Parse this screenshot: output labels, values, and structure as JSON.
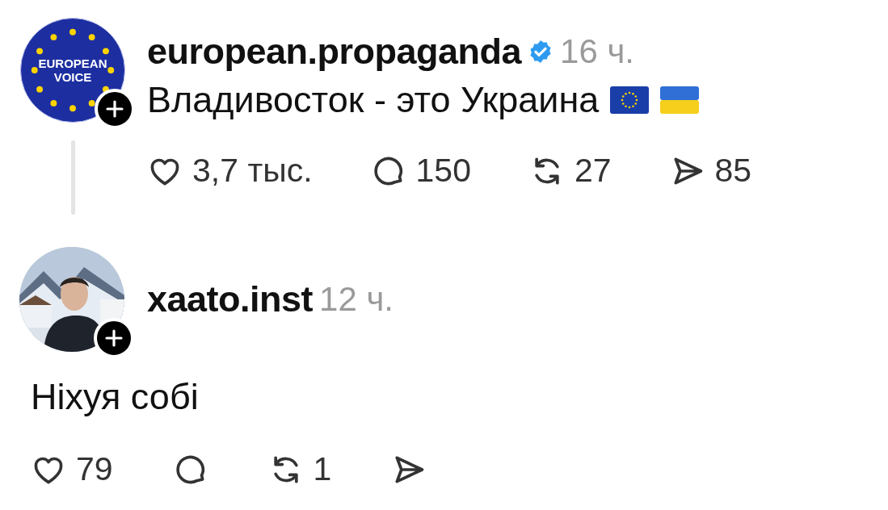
{
  "posts": [
    {
      "avatar": {
        "kind": "logo",
        "lines": [
          "EUROPEAN",
          "VOICE"
        ]
      },
      "username": "european.propaganda",
      "verified": true,
      "time": "16 ч.",
      "text": "Владивосток - это Украина",
      "actions": [
        {
          "kind": "like",
          "count": "3,7 тыс."
        },
        {
          "kind": "reply",
          "count": "150"
        },
        {
          "kind": "repost",
          "count": "27"
        },
        {
          "kind": "share",
          "count": "85"
        }
      ]
    },
    {
      "username": "xaato.inst",
      "verified": false,
      "time": "12 ч.",
      "text": "Ніхуя собі",
      "actions": [
        {
          "kind": "like",
          "count": "79"
        },
        {
          "kind": "reply"
        },
        {
          "kind": "repost",
          "count": "1"
        },
        {
          "kind": "share"
        }
      ]
    }
  ]
}
